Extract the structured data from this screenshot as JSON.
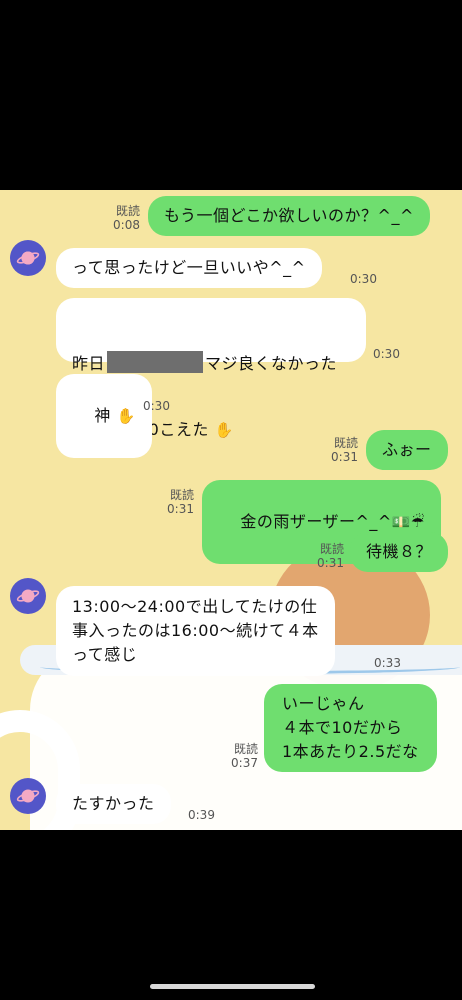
{
  "chat": {
    "read_label": "既読",
    "messages": [
      {
        "id": "m1",
        "side": "sent",
        "text": "もう一個どこか欲しいのか？^_^",
        "time": "0:08",
        "read": true
      },
      {
        "id": "m2",
        "side": "recv",
        "text": "って思ったけど一旦いいや^_^",
        "time": "0:30",
        "avatar": true
      },
      {
        "id": "m3",
        "side": "recv",
        "line1_pre": "昨日",
        "line1_post": "マジ良くなかった",
        "line2": "けど今日10こえた",
        "time": "0:30"
      },
      {
        "id": "m4",
        "side": "recv",
        "text": "神",
        "time": "0:30"
      },
      {
        "id": "m5",
        "side": "sent",
        "text": "ふぉー",
        "time": "0:31",
        "read": true
      },
      {
        "id": "m6",
        "side": "sent",
        "text": "金の雨ザーザー^_^",
        "time": "0:31",
        "read": true
      },
      {
        "id": "m7",
        "side": "sent",
        "text": "待機８？",
        "time": "0:31",
        "read": true
      },
      {
        "id": "m8",
        "side": "recv",
        "text": "13:00〜24:00で出してたけの仕\n事入ったのは16:00〜続けて４本\nって感じ",
        "time": "0:33",
        "avatar": true
      },
      {
        "id": "m9",
        "side": "sent",
        "text": "いーじゃん\n４本で10だから\n1本あたり2.5だな",
        "time": "0:37",
        "read": true
      },
      {
        "id": "m10",
        "side": "recv",
        "text": "たすかった",
        "time": "0:39",
        "avatar": true
      }
    ]
  },
  "icons": {
    "avatar": "planet-icon",
    "hand": "raised-hand-icon",
    "money": "money-bag-icon",
    "umbrella": "umbrella-icon"
  },
  "colors": {
    "background": "#f6e6a2",
    "sent_bubble": "#6fde6f",
    "recv_bubble": "#ffffff",
    "avatar": "#5356c8"
  }
}
